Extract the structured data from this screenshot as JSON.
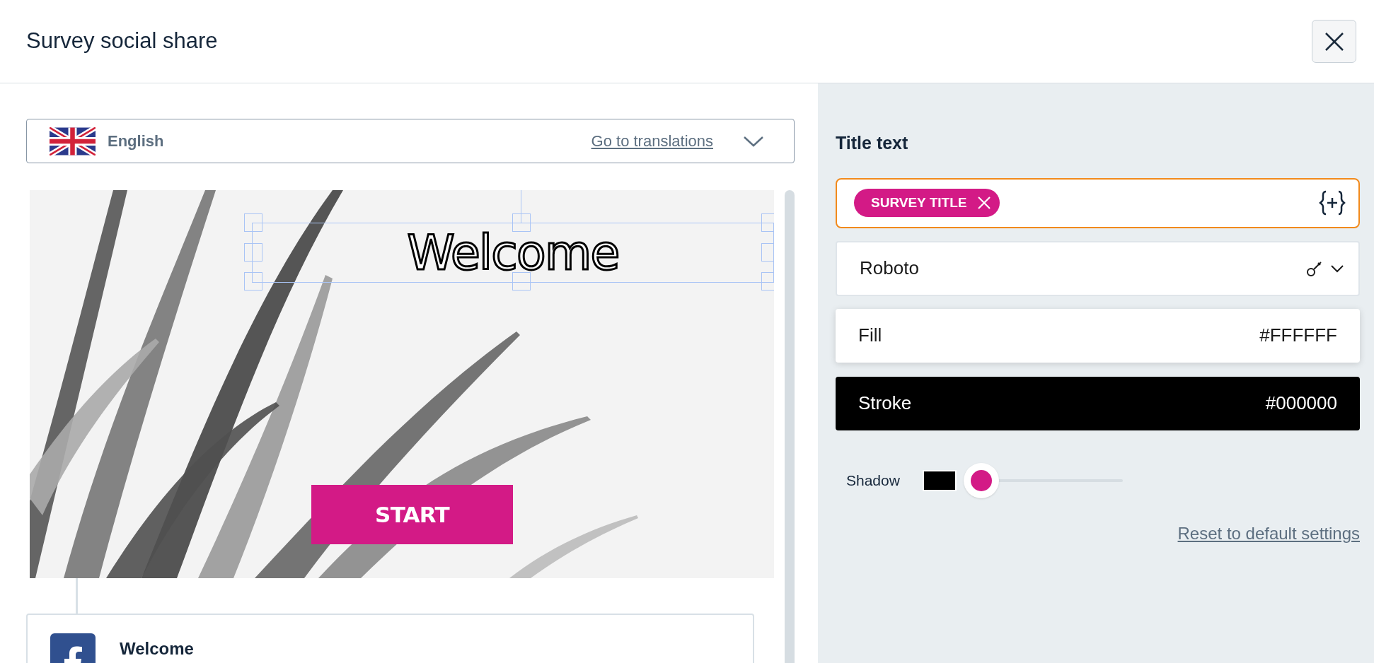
{
  "dialog": {
    "title": "Survey social share"
  },
  "language": {
    "label": "English",
    "link": "Go to translations"
  },
  "preview": {
    "title": "Welcome",
    "button": "START"
  },
  "share_card": {
    "title": "Welcome"
  },
  "panel": {
    "heading": "Title text",
    "tag": "SURVEY TITLE",
    "font": "Roboto",
    "fill": {
      "label": "Fill",
      "value": "#FFFFFF"
    },
    "stroke": {
      "label": "Stroke",
      "value": "#000000"
    },
    "shadow": {
      "label": "Shadow",
      "level": 0.03
    },
    "reset": "Reset to default settings"
  }
}
